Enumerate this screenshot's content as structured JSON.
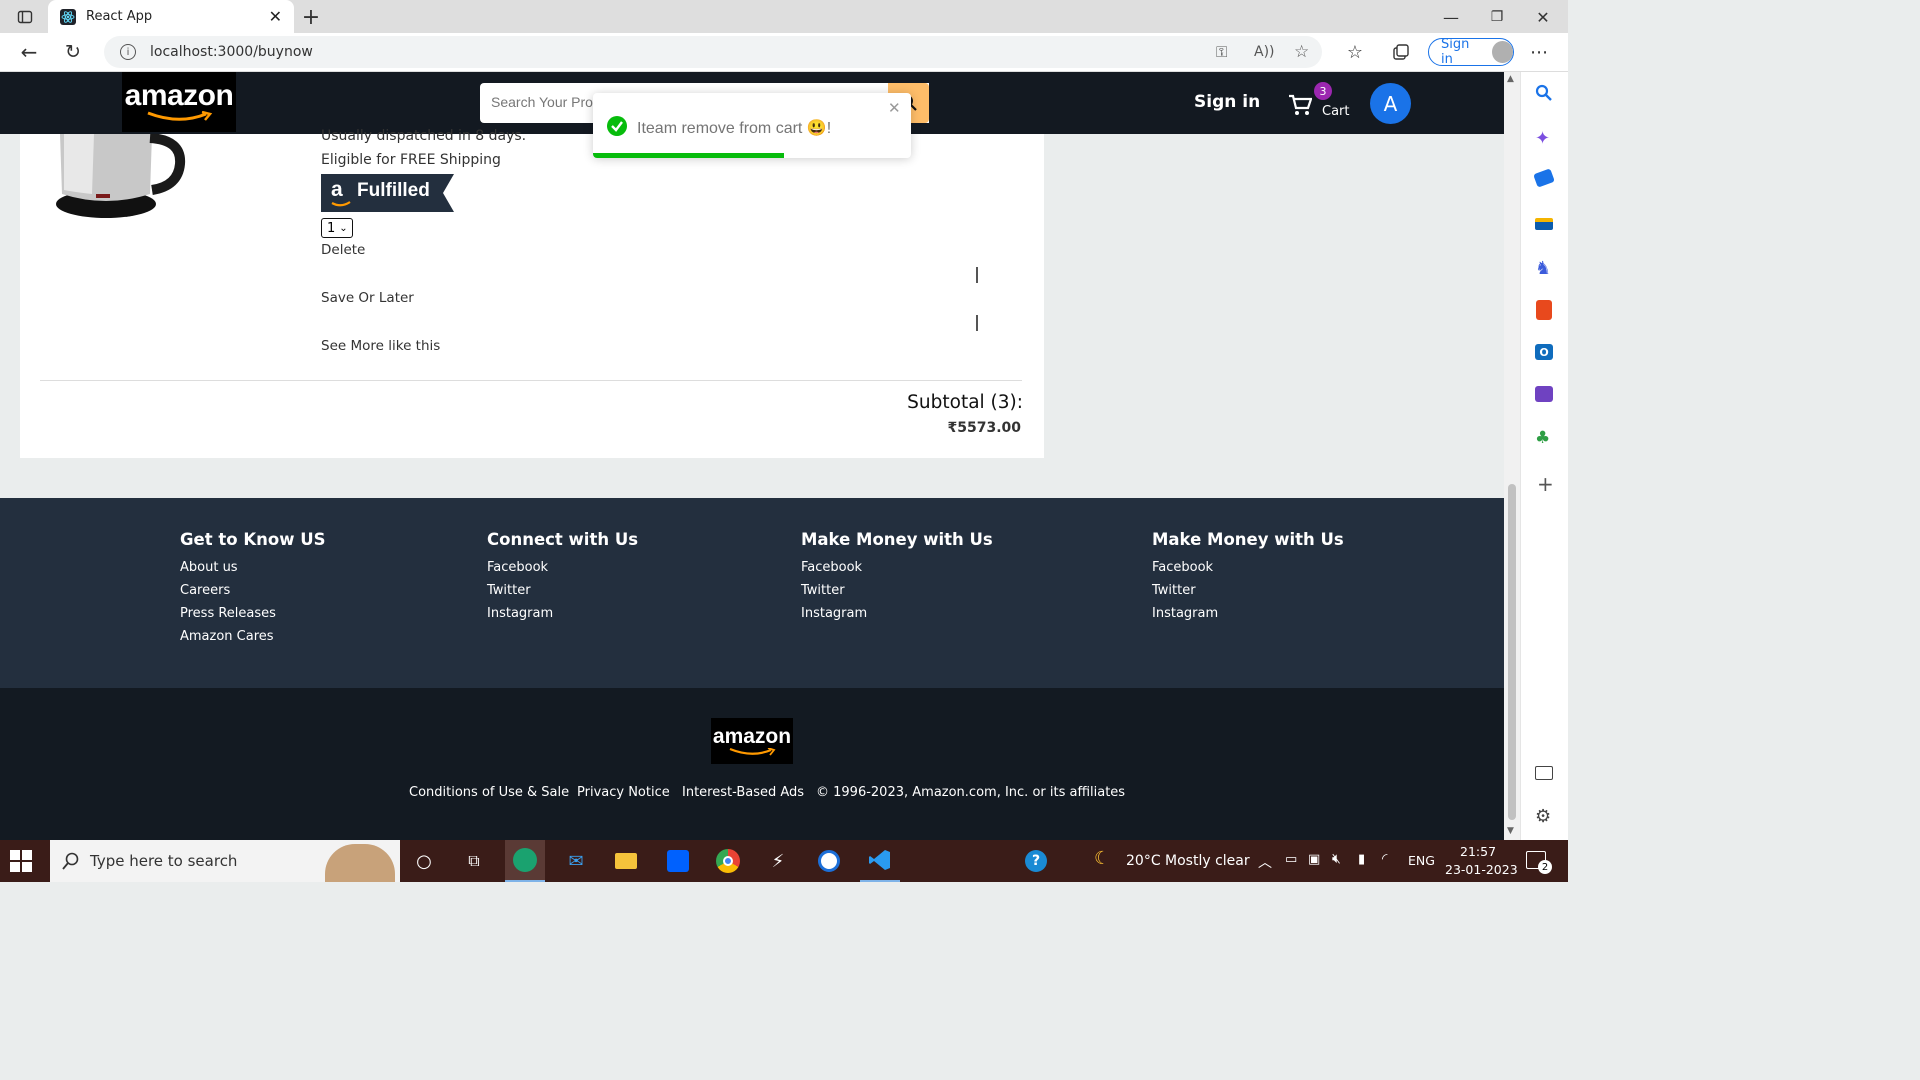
{
  "browser": {
    "tab_title": "React App",
    "url": "localhost:3000/buynow",
    "signin_label": "Sign in"
  },
  "navbar": {
    "logo": "amazon",
    "search_placeholder": "Search Your Pro",
    "signin": "Sign in",
    "cart_count": "3",
    "cart_label": "Cart",
    "avatar_letter": "A"
  },
  "product": {
    "dispatch": "Usually dispatched in 8 days.",
    "shipping": "Eligible for FREE Shipping",
    "fulfilled_badge": "Fulfilled",
    "quantity": "1",
    "actions": [
      "Delete",
      "Save Or Later",
      "See More like this"
    ]
  },
  "subtotal": {
    "label": "Subtotal (3):",
    "amount": "₹5573.00"
  },
  "toast": {
    "message": "Iteam remove from cart 😃!",
    "progress": 0.6
  },
  "footer": {
    "columns": [
      {
        "title": "Get to Know US",
        "links": [
          "About us",
          "Careers",
          "Press Releases",
          "Amazon Cares"
        ]
      },
      {
        "title": "Connect with Us",
        "links": [
          "Facebook",
          "Twitter",
          "Instagram"
        ]
      },
      {
        "title": "Make Money with Us",
        "links": [
          "Facebook",
          "Twitter",
          "Instagram"
        ]
      },
      {
        "title": "Make Money with Us",
        "links": [
          "Facebook",
          "Twitter",
          "Instagram"
        ]
      }
    ],
    "logo": "amazon",
    "bottom_links": [
      "Conditions of Use & Sale",
      "Privacy Notice",
      "Interest-Based Ads",
      "© 1996-2023, Amazon.com, Inc. or its affiliates"
    ]
  },
  "taskbar": {
    "search_placeholder": "Type here to search",
    "weather": "20°C  Mostly clear",
    "lang": "ENG",
    "time": "21:57",
    "date": "23-01-2023",
    "notif_count": "2"
  },
  "colors": {
    "nav_bg": "#131921",
    "footer_bg": "#232f3e",
    "footer2_bg": "#131a22",
    "search_btn": "#febd69",
    "toast_green": "#07bc0c",
    "avatar_blue": "#1a73e8",
    "cart_badge": "#9c27b0"
  }
}
